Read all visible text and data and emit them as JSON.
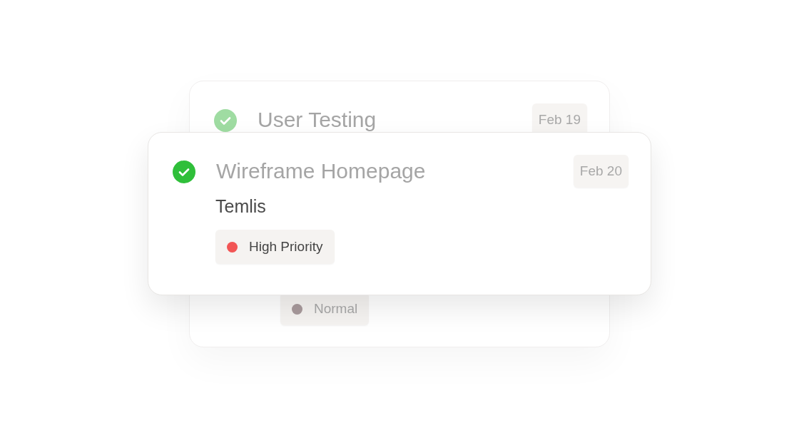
{
  "cards": [
    {
      "kind": "back",
      "title": "User Testing",
      "date": "Feb 19",
      "done": true,
      "tag": {
        "label": "Normal",
        "color": "#a89a9c"
      }
    },
    {
      "kind": "front",
      "title": "Wireframe Homepage",
      "date": "Feb 20",
      "done": true,
      "project": "Temlis",
      "tag": {
        "label": "High Priority",
        "color": "#f25555"
      }
    }
  ]
}
